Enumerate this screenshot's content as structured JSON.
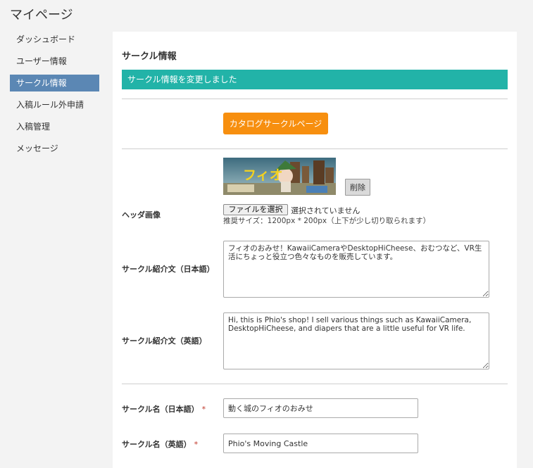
{
  "page": {
    "title": "マイページ"
  },
  "sidebar": {
    "items": [
      {
        "label": "ダッシュボード"
      },
      {
        "label": "ユーザー情報"
      },
      {
        "label": "サークル情報"
      },
      {
        "label": "入稿ルール外申請"
      },
      {
        "label": "入稿管理"
      },
      {
        "label": "メッセージ"
      }
    ],
    "active_index": 2
  },
  "main": {
    "section_title": "サークル情報",
    "alert_message": "サークル情報を変更しました",
    "catalog_button": "カタログサークルページ",
    "header_image": {
      "label": "ヘッダ画像",
      "image_text": "フィオ",
      "delete_button": "削除",
      "file_button": "ファイルを選択",
      "file_status": "選択されていません",
      "hint": "推奨サイズ：1200px * 200px（上下が少し切り取られます）"
    },
    "intro_ja": {
      "label": "サークル紹介文（日本語）",
      "value": "フィオのおみせ！KawaiiCameraやDesktopHiCheese、おむつなど、VR生活にちょっと役立つ色々なものを販売しています。"
    },
    "intro_en": {
      "label": "サークル紹介文（英語）",
      "value": "Hi, this is Phio's shop! I sell various things such as KawaiiCamera, DesktopHiCheese, and diapers that are a little useful for VR life."
    },
    "name_ja": {
      "label": "サークル名（日本語）",
      "required_mark": "*",
      "value": "動く城のフィオのおみせ"
    },
    "name_en": {
      "label": "サークル名（英語）",
      "required_mark": "*",
      "value": "Phio's Moving Castle"
    }
  },
  "colors": {
    "accent": "#5b87b4",
    "alert": "#22b3a8",
    "catalog_button": "#f78f0f",
    "required": "#c0392b"
  }
}
